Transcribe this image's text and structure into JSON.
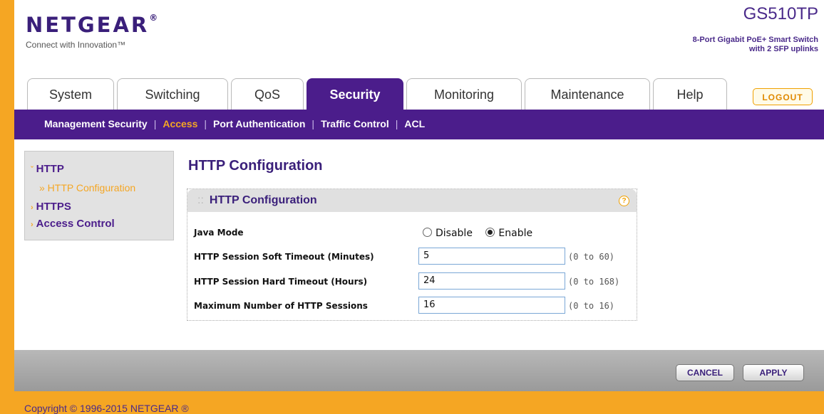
{
  "brand": {
    "logo": "NETGEAR",
    "logo_mark": "®",
    "tagline": "Connect with Innovation™",
    "model": "GS510TP",
    "model_desc_1": "8-Port Gigabit PoE+ Smart Switch",
    "model_desc_2": "with 2 SFP uplinks"
  },
  "tabs": [
    {
      "label": "System"
    },
    {
      "label": "Switching"
    },
    {
      "label": "QoS"
    },
    {
      "label": "Security"
    },
    {
      "label": "Monitoring"
    },
    {
      "label": "Maintenance"
    },
    {
      "label": "Help"
    }
  ],
  "logout_label": "LOGOUT",
  "subnav": {
    "items": [
      "Management Security",
      "Access",
      "Port Authentication",
      "Traffic Control",
      "ACL"
    ],
    "separator": "|"
  },
  "leftnav": {
    "http": "HTTP",
    "http_config": "» HTTP Configuration",
    "https": "HTTPS",
    "access_control": "Access Control"
  },
  "page_title": "HTTP Configuration",
  "panel": {
    "title": "HTTP Configuration",
    "help_icon": "?",
    "java_mode_label": "Java Mode",
    "radio_disable": "Disable",
    "radio_enable": "Enable",
    "soft_timeout_label": "HTTP Session Soft Timeout (Minutes)",
    "soft_timeout_value": "5",
    "soft_timeout_range": "(0 to 60)",
    "hard_timeout_label": "HTTP Session Hard Timeout (Hours)",
    "hard_timeout_value": "24",
    "hard_timeout_range": "(0 to 168)",
    "max_sessions_label": "Maximum Number of HTTP Sessions",
    "max_sessions_value": "16",
    "max_sessions_range": "(0 to 16)"
  },
  "buttons": {
    "cancel": "CANCEL",
    "apply": "APPLY"
  },
  "copyright": "Copyright © 1996-2015 NETGEAR ®"
}
